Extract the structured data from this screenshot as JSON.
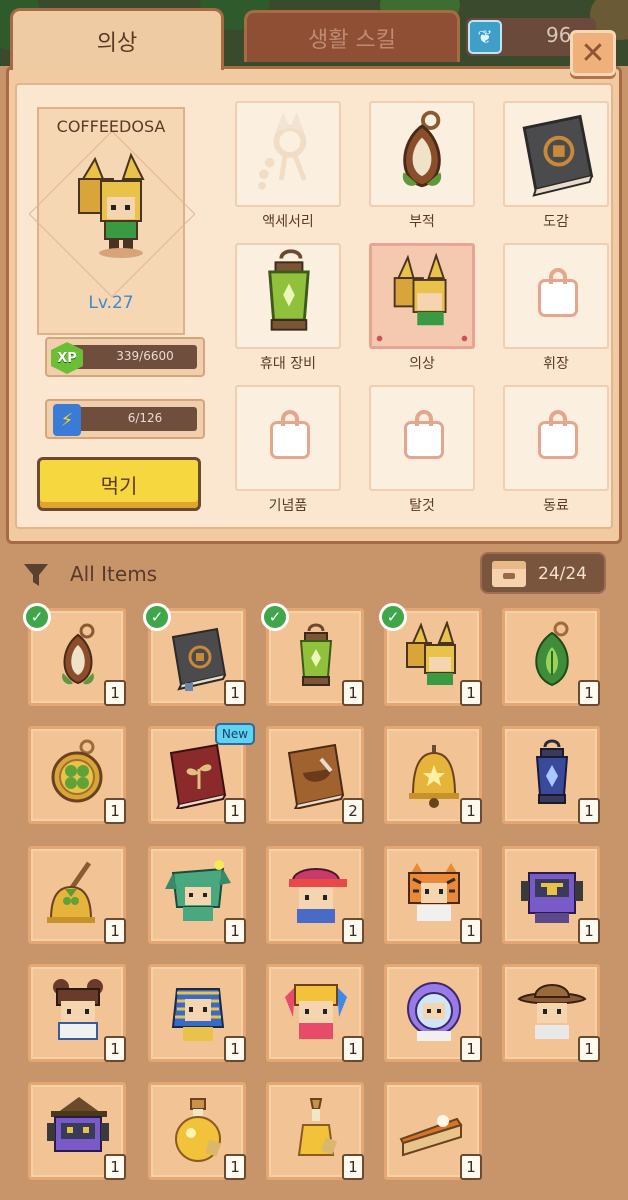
{
  "tabs": {
    "costume": "의상",
    "life_skill": "생활 스킬"
  },
  "currency": {
    "value": "96",
    "icon": "leaf-gem-icon"
  },
  "character": {
    "name": "COFFEEDOSA",
    "level": "Lv.27",
    "xp": "339/6600",
    "sp": "6/126",
    "xp_badge": "XP",
    "sp_badge": "SP"
  },
  "eat_button": "먹기",
  "slots": [
    {
      "label": "액세서리",
      "icon": "accessory-icon",
      "locked": false
    },
    {
      "label": "부적",
      "icon": "charm-icon",
      "locked": false
    },
    {
      "label": "도감",
      "icon": "book-icon",
      "locked": false
    },
    {
      "label": "휴대 장비",
      "icon": "lantern-icon",
      "locked": false
    },
    {
      "label": "의상",
      "icon": "costume-icon",
      "locked": false,
      "selected": true
    },
    {
      "label": "휘장",
      "icon": "lock-icon",
      "locked": true
    },
    {
      "label": "기념품",
      "icon": "lock-icon",
      "locked": true
    },
    {
      "label": "탈것",
      "icon": "lock-icon",
      "locked": true
    },
    {
      "label": "동료",
      "icon": "lock-icon",
      "locked": true
    }
  ],
  "filter": {
    "label": "All Items",
    "icon": "filter-funnel-icon"
  },
  "capacity": {
    "value": "24/24",
    "icon": "storage-box-icon"
  },
  "new_badge": "New",
  "items": [
    {
      "icon": "acorn-charm-icon",
      "count": "1",
      "equipped": true
    },
    {
      "icon": "gear-book-icon",
      "count": "1",
      "equipped": true
    },
    {
      "icon": "green-lantern-icon",
      "count": "1",
      "equipped": true
    },
    {
      "icon": "horned-helmet-costume-icon",
      "count": "1",
      "equipped": true
    },
    {
      "icon": "leaf-charm-icon",
      "count": "1"
    },
    {
      "icon": "clover-medallion-icon",
      "count": "1"
    },
    {
      "icon": "sprout-book-icon",
      "count": "1",
      "new": true
    },
    {
      "icon": "mortar-book-icon",
      "count": "2"
    },
    {
      "icon": "star-bell-icon",
      "count": "1"
    },
    {
      "icon": "blue-lantern-icon",
      "count": "1"
    },
    {
      "icon": "clover-bell-icon",
      "count": "1"
    },
    {
      "icon": "green-monster-costume-icon",
      "count": "1"
    },
    {
      "icon": "red-cap-costume-icon",
      "count": "1"
    },
    {
      "icon": "tiger-costume-icon",
      "count": "1"
    },
    {
      "icon": "robot-costume-icon",
      "count": "1"
    },
    {
      "icon": "bun-hair-costume-icon",
      "count": "1"
    },
    {
      "icon": "pharaoh-costume-icon",
      "count": "1"
    },
    {
      "icon": "twin-tail-costume-icon",
      "count": "1"
    },
    {
      "icon": "astronaut-costume-icon",
      "count": "1"
    },
    {
      "icon": "cowboy-costume-icon",
      "count": "1"
    },
    {
      "icon": "witch-robot-costume-icon",
      "count": "1"
    },
    {
      "icon": "round-potion-icon",
      "count": "1"
    },
    {
      "icon": "tall-potion-icon",
      "count": "1"
    },
    {
      "icon": "pie-slice-icon",
      "count": "1"
    }
  ],
  "colors": {
    "panel": "#f1caa1",
    "background": "#c8946a",
    "accent_button": "#f7d73f",
    "check": "#3fa64a"
  }
}
